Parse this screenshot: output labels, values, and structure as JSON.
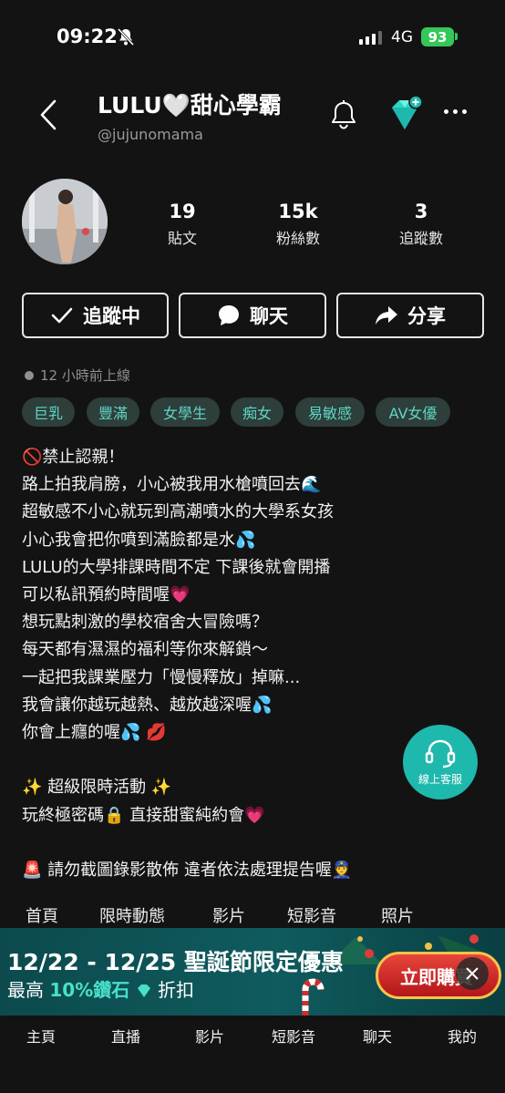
{
  "status": {
    "time": "09:22",
    "network": "4G",
    "battery": "93"
  },
  "header": {
    "name": "LULU🤍甜心學霸",
    "handle": "@jujunomama"
  },
  "stats": [
    {
      "value": "19",
      "label": "貼文"
    },
    {
      "value": "15k",
      "label": "粉絲數"
    },
    {
      "value": "3",
      "label": "追蹤數"
    }
  ],
  "actions": {
    "follow": "追蹤中",
    "chat": "聊天",
    "share": "分享"
  },
  "online_status": "12 小時前上線",
  "tags": [
    "巨乳",
    "豐滿",
    "女學生",
    "痴女",
    "易敏感",
    "AV女優"
  ],
  "bio": "🚫禁止認親！\n路上拍我肩膀，小心被我用水槍噴回去🌊\n超敏感不小心就玩到高潮噴水的大學系女孩\n小心我會把你噴到滿臉都是水💦\nLULU的大學排課時間不定 下課後就會開播\n可以私訊預約時間喔💗\n想玩點刺激的學校宿舍大冒險嗎？\n每天都有濕濕的福利等你來解鎖～\n一起把我課業壓力「慢慢釋放」掉嘛...\n我會讓你越玩越熱、越放越深喔💦\n你會上癮的喔💦 💋\n\n✨ 超級限時活動 ✨\n玩終極密碼🔒 直接甜蜜純約會💗\n\n🚨 請勿截圖錄影散佈 違者依法處理提告喔👮",
  "support_label": "線上客服",
  "content_tabs": [
    "首頁",
    "限時動態",
    "影片",
    "短影音",
    "照片"
  ],
  "promo": {
    "title": "12/22 - 12/25  聖誕節限定優惠",
    "sub_prefix": "最高",
    "sub_accent": "10%鑽石",
    "sub_suffix": "折扣",
    "button": "立即購買"
  },
  "bottom_nav": [
    "主頁",
    "直播",
    "影片",
    "短影音",
    "聊天",
    "我的"
  ],
  "colors": {
    "accent": "#1fb8ad",
    "tag_text": "#5fd6c6",
    "tag_bg": "#2d3e3b",
    "diamond": "#2ad6c3",
    "battery": "#35c759"
  }
}
